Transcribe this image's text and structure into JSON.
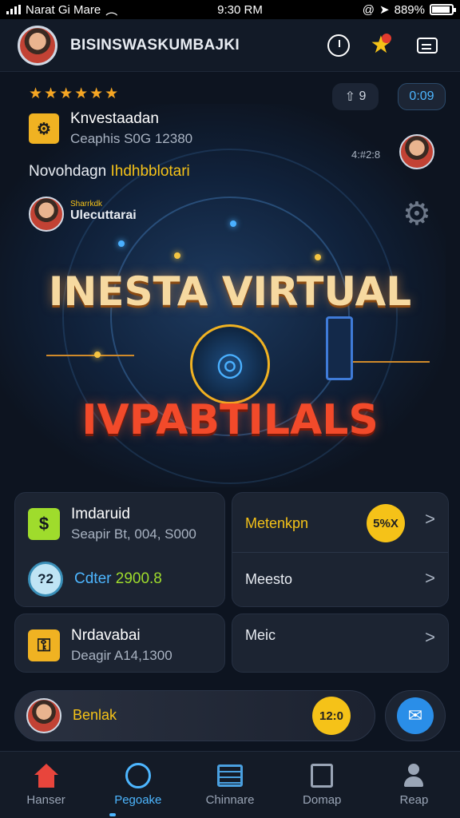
{
  "status_bar": {
    "carrier": "Narat Gi Mare",
    "time": "9:30 RM",
    "battery": "889%",
    "battery_level": 0.89
  },
  "header": {
    "title": "BISINSWASKUMBAJKI"
  },
  "hero": {
    "rating_stars": "★★★★★★",
    "pill_left": "9",
    "pill_timer": "0:09",
    "app_name": "Knvestaadan",
    "app_subtitle": "Ceaphis S0G 12380",
    "side_label": "4:#2:8",
    "line_text_a": "Novohdagn",
    "line_text_b": "Ihdhbblotari",
    "user_small": "Sharrkdk",
    "user_name": "Ulecuttarai",
    "headline_1": "INESTA VIRTUAL",
    "headline_2": "IVPABTILALS"
  },
  "cards": {
    "c1": {
      "title": "Imdaruid",
      "sub": "Seapir Bt, 004, S000"
    },
    "c2": {
      "badge": "?2",
      "label": "Cdter",
      "value": "2900.8"
    },
    "c3": {
      "label": "Metenkpn",
      "badge": "5%X"
    },
    "c4": {
      "label": "Meesto"
    },
    "c5": {
      "title": "Nrdavabai",
      "sub": "Deagir A14,1300"
    },
    "c6": {
      "label": "Meic"
    }
  },
  "promo": {
    "label": "Benlak",
    "badge": "12:0"
  },
  "nav": {
    "items": [
      {
        "label": "Hanser"
      },
      {
        "label": "Pegoake"
      },
      {
        "label": "Chinnare"
      },
      {
        "label": "Domap"
      },
      {
        "label": "Reap"
      }
    ]
  },
  "colors": {
    "accent": "#4db6ff",
    "gold": "#f5c218",
    "bg": "#0d1420"
  }
}
